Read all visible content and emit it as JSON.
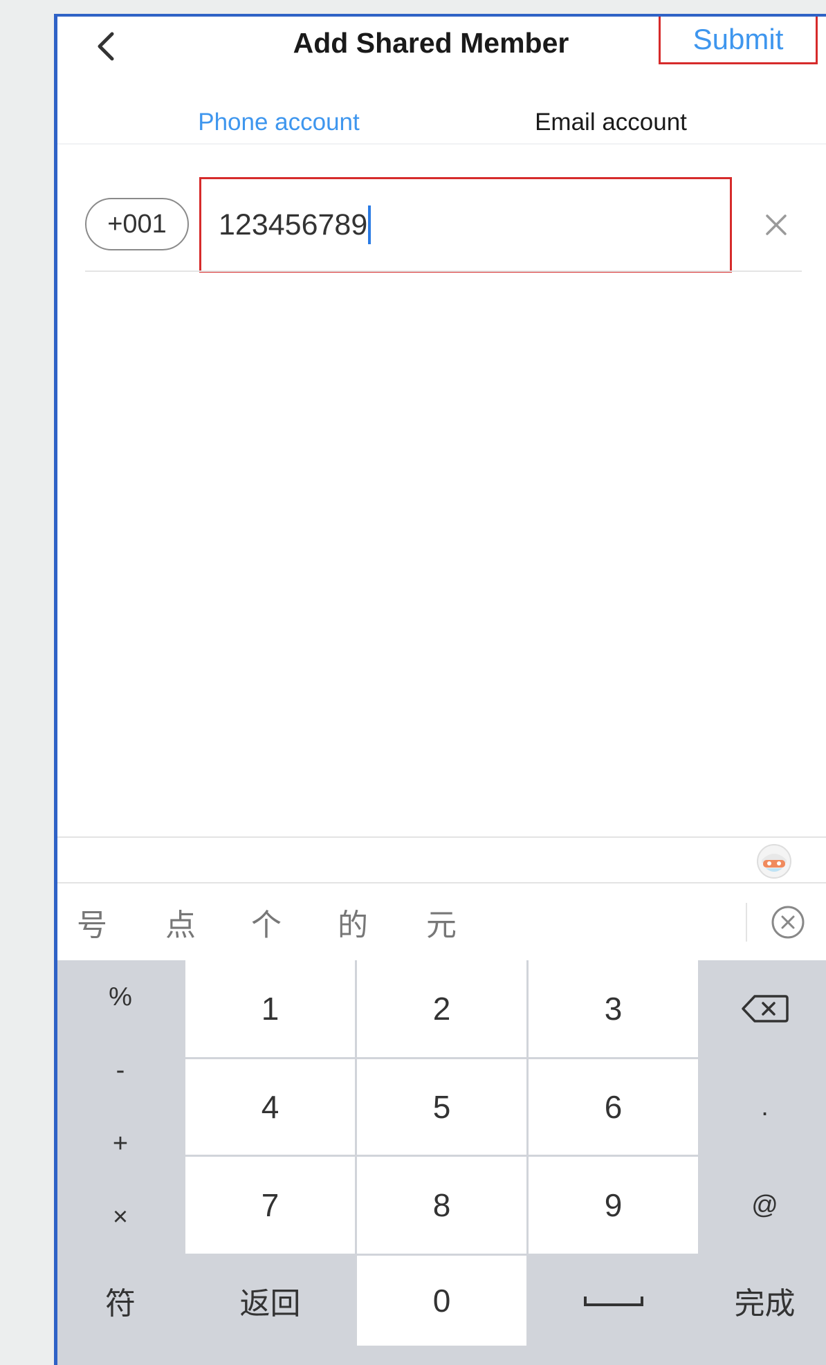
{
  "header": {
    "title": "Add Shared Member",
    "submit_label": "Submit"
  },
  "tabs": [
    {
      "label": "Phone account",
      "active": true
    },
    {
      "label": "Email account",
      "active": false
    }
  ],
  "phone_input": {
    "country_code": "+001",
    "value": "123456789"
  },
  "candidates": [
    "号",
    "点",
    "个",
    "的",
    "元"
  ],
  "keyboard": {
    "symbols": [
      "%",
      "-",
      "+",
      "×"
    ],
    "digits": [
      "1",
      "2",
      "3",
      "4",
      "5",
      "6",
      "7",
      "8",
      "9"
    ],
    "right_keys": [
      ".",
      "@"
    ],
    "bottom": {
      "symbol_key": "符",
      "back_key": "返回",
      "zero_key": "0",
      "space_key": "space",
      "done_key": "完成"
    }
  },
  "colors": {
    "accent": "#3e96ee",
    "annotation_red": "#d62b2b",
    "annotation_blue": "#2f62c6",
    "keyboard_gray": "#d1d4da"
  },
  "icons": {
    "back": "chevron-left-icon",
    "clear": "close-icon",
    "delete": "backspace-icon",
    "candidates_close": "circle-close-icon",
    "keyboard_mascot": "mascot-icon"
  }
}
